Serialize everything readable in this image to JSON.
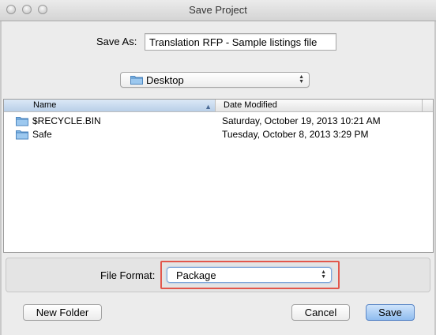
{
  "window": {
    "title": "Save Project"
  },
  "save_as": {
    "label": "Save As:",
    "value": "Translation RFP - Sample listings file"
  },
  "location": {
    "value": "Desktop"
  },
  "browser": {
    "columns": [
      "Name",
      "Date Modified"
    ],
    "rows": [
      {
        "name": "$RECYCLE.BIN",
        "date": "Saturday, October 19, 2013 10:21 AM"
      },
      {
        "name": "Safe",
        "date": "Tuesday, October 8, 2013 3:29 PM"
      }
    ]
  },
  "file_format": {
    "label": "File Format:",
    "value": "Package"
  },
  "buttons": {
    "new_folder": "New Folder",
    "cancel": "Cancel",
    "save": "Save"
  },
  "colors": {
    "highlight": "#e2574c",
    "default_button": "#8fbcef",
    "folder": "#7fb6e6"
  }
}
